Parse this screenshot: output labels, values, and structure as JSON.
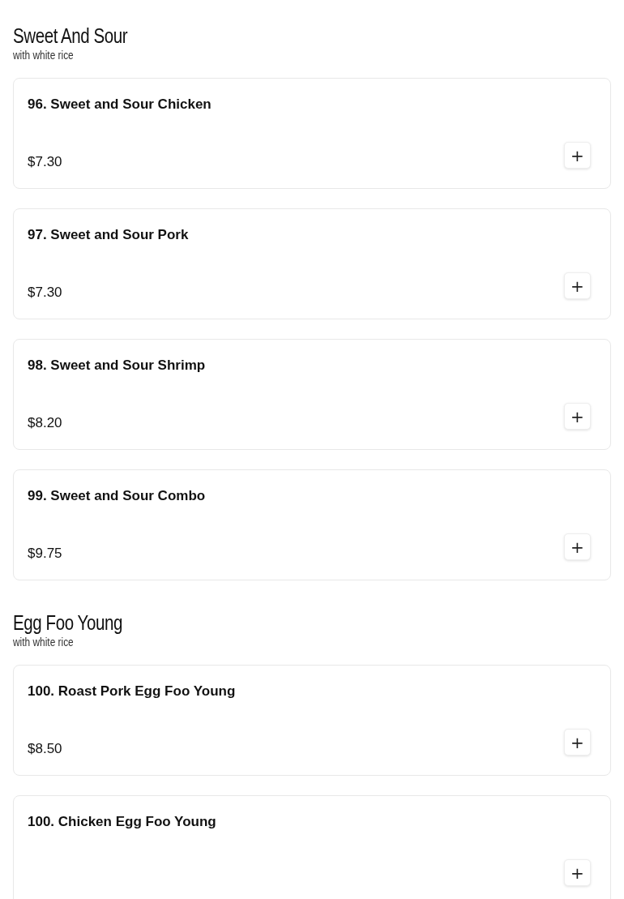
{
  "sections": [
    {
      "title": "Sweet And Sour",
      "subtitle": "with white rice",
      "items": [
        {
          "name": "96. Sweet and Sour Chicken",
          "price": "$7.30",
          "add": "+"
        },
        {
          "name": "97. Sweet and Sour Pork",
          "price": "$7.30",
          "add": "+"
        },
        {
          "name": "98. Sweet and Sour Shrimp",
          "price": "$8.20",
          "add": "+"
        },
        {
          "name": "99. Sweet and Sour Combo",
          "price": "$9.75",
          "add": "+"
        }
      ]
    },
    {
      "title": "Egg Foo Young",
      "subtitle": "with white rice",
      "items": [
        {
          "name": "100. Roast Pork Egg Foo Young",
          "price": "$8.50",
          "add": "+"
        },
        {
          "name": "100. Chicken Egg Foo Young",
          "add": "+"
        }
      ]
    }
  ]
}
